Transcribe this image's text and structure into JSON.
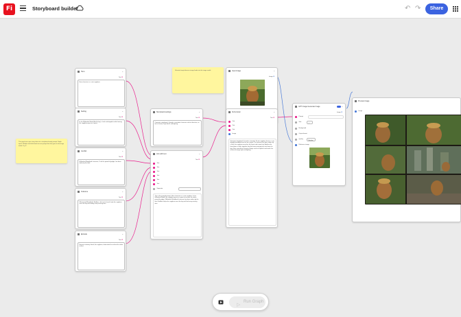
{
  "app": {
    "logo_text": "Fi",
    "title": "Storyboard builder",
    "share_label": "Share",
    "run_label": "Run Graph"
  },
  "icons": {
    "menu": "hamburger-icon",
    "cloud": "cloud-icon",
    "undo": "undo-icon",
    "redo": "redo-icon",
    "apps": "apps-grid-icon",
    "run": "run-graph-icon"
  },
  "colors": {
    "brand": "#e8121f",
    "accent": "#3b63e0",
    "wire": "#e91e8c",
    "wire_image": "#4a7bd8",
    "sticky": "#fff69e"
  },
  "stickies": {
    "left": "This graph turns your story idea into a storyboard-ready prompt. Single inputs. Multiple text fields feed into one prompt that then goes to the image model. Try it!",
    "top": "Selected story/reference image feeds into the image model."
  },
  "nodes": {
    "n1": {
      "title": "Hero",
      "text": "Hero character is a cute capybara.",
      "port": "Text"
    },
    "n2": {
      "title": "Setting",
      "text": "In the Willowleaf Wood (Bird's Eye), a lush and dappled sunlit clearing, the capybara goes on a quest.",
      "port": "Text"
    },
    "n3": {
      "title": "Conflict",
      "text": "Willowleaf Woodland's treasure, Truth the powerful gadget, has been stolen by the thief.",
      "port": "Text"
    },
    "n4": {
      "title": "Outcome",
      "text": "Villainwood Woodland's Bodkins, the hero's friend, helps the capybara save the day and finding every missing item.",
      "port": "Text"
    },
    "n5": {
      "title": "Episode",
      "text": "Nascent visionary friend, the capybara, determined to reclaim the stolen artifact.",
      "port": "Text"
    },
    "storyboard": {
      "title": "Storyboard settings",
      "text": "Cinematic storyboard, 4 panels, consistent character and art direction, no text in frames, high detail, soft lighting.",
      "port": "Text"
    },
    "join": {
      "title": "Join with text",
      "ports": [
        "Text",
        "Text",
        "Text",
        "Text",
        "Text",
        "Text"
      ],
      "separator_label": "Separator",
      "result_text": "This is the merged prompt: Hero character is a cute capybara. In the Willowleaf Wood, the capybara goes on a quest to recover the stolen powerful gadget. Willowleaf Woodland's treasure has been stolen by the thief. Bodkins helps the capybara save the day and find every missing item.",
      "port": "Text"
    },
    "input_image": {
      "title": "Input image",
      "port": "Image"
    },
    "full_prompt": {
      "title": "Full prompt",
      "ports": [
        "Text",
        "Text",
        "Text",
        "Image"
      ],
      "result_text": "Generate storyboard: 4 panels, cinematic. A cute capybara hero in a sun-dappled woodland sets out on a quest. The treasure has been stolen by a thief; the capybara searches the forest and ruined city. Bodkins the friend joins to help; together they find every missing item and save the day. Keep consistent character design across all panels and match the reference image style and lighting.",
      "port": "Text"
    },
    "gen": {
      "title": "GPT Image Generate Image",
      "rows": [
        "Prompt",
        "Size",
        "Background",
        "Output format",
        "Quality",
        "Reference image"
      ],
      "size_value": "1",
      "quality_value": "Medium",
      "port": "Image"
    },
    "preview": {
      "title": "Preview image",
      "port": "Image"
    }
  }
}
